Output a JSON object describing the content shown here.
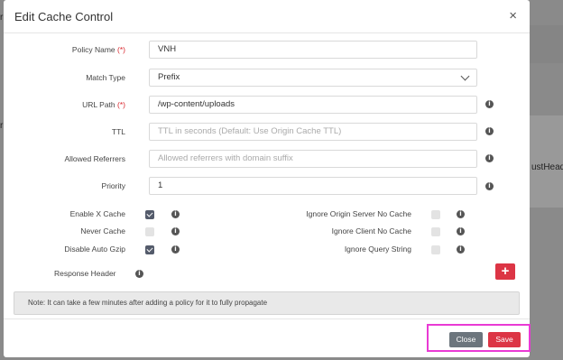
{
  "backdrop": {
    "left_fragment_1": "r",
    "left_fragment_2": "r",
    "right_fragment": "ustHead"
  },
  "modal": {
    "title": "Edit Cache Control",
    "close_glyph": "×",
    "icons": {
      "close": "close-icon",
      "info": "info-circle-icon",
      "dropdown": "chevron-down-icon",
      "add": "plus-icon"
    }
  },
  "form": {
    "policy_name": {
      "label": "Policy Name",
      "required_mark": "(*)",
      "value": "VNH"
    },
    "match_type": {
      "label": "Match Type",
      "value": "Prefix"
    },
    "url_path": {
      "label": "URL Path",
      "required_mark": "(*)",
      "value": "/wp-content/uploads"
    },
    "ttl": {
      "label": "TTL",
      "value": "",
      "placeholder": "TTL in seconds (Default: Use Origin Cache TTL)"
    },
    "allowed_referrers": {
      "label": "Allowed Referrers",
      "value": "",
      "placeholder": "Allowed referrers with domain suffix"
    },
    "priority": {
      "label": "Priority",
      "value": "1"
    }
  },
  "checkboxes": {
    "enable_x_cache": {
      "label": "Enable X Cache",
      "checked": true
    },
    "never_cache": {
      "label": "Never Cache",
      "checked": false
    },
    "disable_auto_gzip": {
      "label": "Disable Auto Gzip",
      "checked": true
    },
    "ignore_origin_no_cache": {
      "label": "Ignore Origin Server No Cache",
      "checked": false
    },
    "ignore_client_no_cache": {
      "label": "Ignore Client No Cache",
      "checked": false
    },
    "ignore_query_string": {
      "label": "Ignore Query String",
      "checked": false
    }
  },
  "response_header": {
    "label": "Response Header",
    "add_glyph": "+"
  },
  "note": "Note: It can take a few minutes after adding a policy for it to fully propagate",
  "footer": {
    "close_label": "Close",
    "save_label": "Save"
  },
  "colors": {
    "primary_red": "#dc3545",
    "secondary_gray": "#6c757d",
    "highlight": "#e93ad4"
  }
}
